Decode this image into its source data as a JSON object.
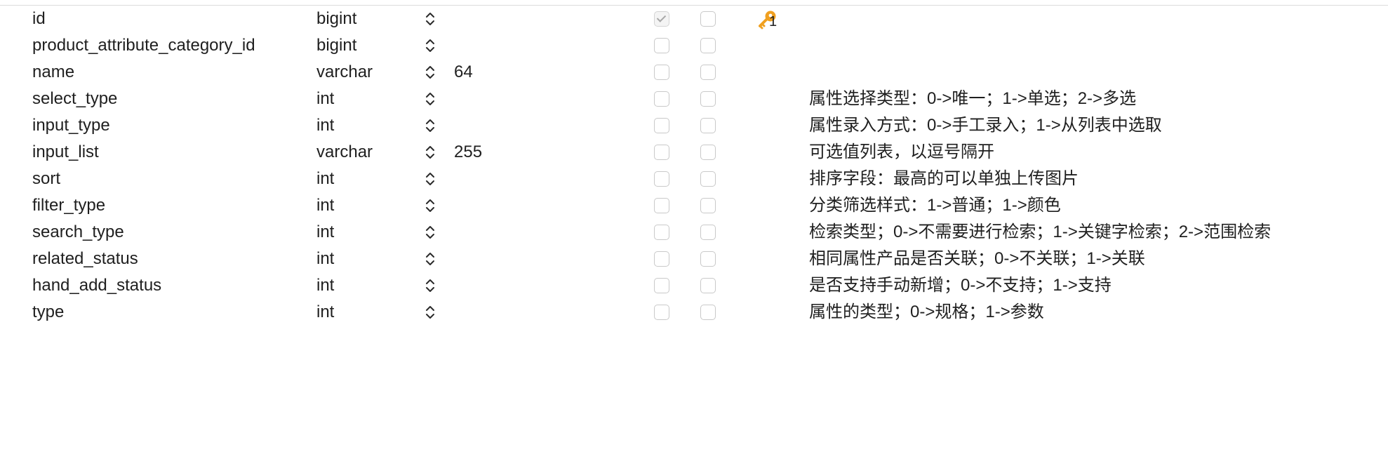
{
  "columns_table": {
    "rows": [
      {
        "name": "id",
        "type": "bigint",
        "length": "",
        "not_null": true,
        "virtual": false,
        "key": "1",
        "comment": ""
      },
      {
        "name": "product_attribute_category_id",
        "type": "bigint",
        "length": "",
        "not_null": false,
        "virtual": false,
        "key": "",
        "comment": ""
      },
      {
        "name": "name",
        "type": "varchar",
        "length": "64",
        "not_null": false,
        "virtual": false,
        "key": "",
        "comment": ""
      },
      {
        "name": "select_type",
        "type": "int",
        "length": "",
        "not_null": false,
        "virtual": false,
        "key": "",
        "comment": "属性选择类型：0->唯一；1->单选；2->多选"
      },
      {
        "name": "input_type",
        "type": "int",
        "length": "",
        "not_null": false,
        "virtual": false,
        "key": "",
        "comment": "属性录入方式：0->手工录入；1->从列表中选取"
      },
      {
        "name": "input_list",
        "type": "varchar",
        "length": "255",
        "not_null": false,
        "virtual": false,
        "key": "",
        "comment": "可选值列表，以逗号隔开"
      },
      {
        "name": "sort",
        "type": "int",
        "length": "",
        "not_null": false,
        "virtual": false,
        "key": "",
        "comment": "排序字段：最高的可以单独上传图片"
      },
      {
        "name": "filter_type",
        "type": "int",
        "length": "",
        "not_null": false,
        "virtual": false,
        "key": "",
        "comment": "分类筛选样式：1->普通；1->颜色"
      },
      {
        "name": "search_type",
        "type": "int",
        "length": "",
        "not_null": false,
        "virtual": false,
        "key": "",
        "comment": "检索类型；0->不需要进行检索；1->关键字检索；2->范围检索"
      },
      {
        "name": "related_status",
        "type": "int",
        "length": "",
        "not_null": false,
        "virtual": false,
        "key": "",
        "comment": "相同属性产品是否关联；0->不关联；1->关联"
      },
      {
        "name": "hand_add_status",
        "type": "int",
        "length": "",
        "not_null": false,
        "virtual": false,
        "key": "",
        "comment": "是否支持手动新增；0->不支持；1->支持"
      },
      {
        "name": "type",
        "type": "int",
        "length": "",
        "not_null": false,
        "virtual": false,
        "key": "",
        "comment": "属性的类型；0->规格；1->参数"
      }
    ]
  },
  "icons": {
    "type_stepper": "chevron-up-down-icon",
    "primary_key": "key-icon"
  },
  "colors": {
    "key_icon": "#f0a020",
    "checkbox_border": "#c9c9c9",
    "text": "#1f1f1f"
  }
}
